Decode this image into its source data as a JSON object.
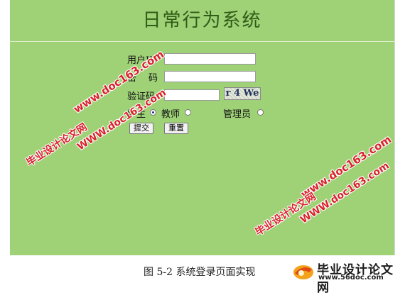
{
  "system_title": "日常行为系统",
  "form": {
    "user_id_label": "用户ID",
    "password_label_part1": "密",
    "password_label_part2": "码",
    "captcha_label": "验证码",
    "captcha_text": "r 4 We",
    "user_id_value": "",
    "password_value": "",
    "captcha_value": "",
    "roles": [
      {
        "label": "学生",
        "selected": true
      },
      {
        "label": "教师",
        "selected": false
      },
      {
        "label": "管理员",
        "selected": false
      }
    ],
    "submit_label": "提交",
    "reset_label": "重置"
  },
  "watermarks": {
    "site_name": "毕业设计论文网",
    "site_url_1": "www.doc163.com",
    "site_url_2": "WWW.doc163.com",
    "site_url_3": "www.doc163.com",
    "site_name_2": "毕业设计论文网",
    "site_url_4": "WWW.doc163.com"
  },
  "caption": "图 5-2 系统登录页面实现",
  "footer_logo": {
    "name": "毕业设计论文网",
    "url": "www.56doc.com"
  }
}
